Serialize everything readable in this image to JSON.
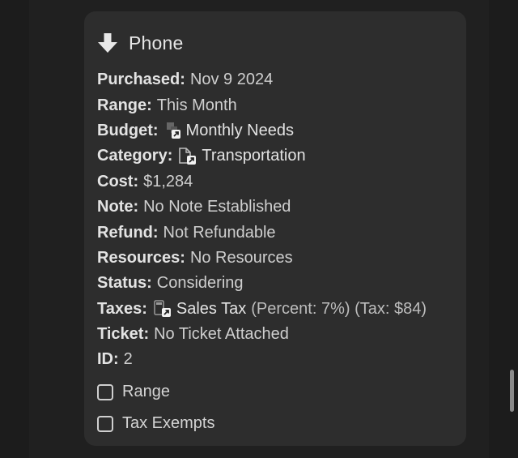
{
  "card": {
    "title": "Phone",
    "icon": "arrow-down-icon"
  },
  "properties": {
    "purchased": {
      "label": "Purchased:",
      "value": "Nov 9 2024"
    },
    "range": {
      "label": "Range:",
      "value": "This Month"
    },
    "budget": {
      "label": "Budget:",
      "value": "Monthly Needs",
      "icon": "page-link-icon"
    },
    "category": {
      "label": "Category:",
      "value": "Transportation",
      "icon": "document-link-icon"
    },
    "cost": {
      "label": "Cost:",
      "value": "$1,284"
    },
    "note": {
      "label": "Note:",
      "value": "No Note Established"
    },
    "refund": {
      "label": "Refund:",
      "value": "Not Refundable"
    },
    "resources": {
      "label": "Resources:",
      "value": "No Resources"
    },
    "status": {
      "label": "Status:",
      "value": "Considering"
    },
    "taxes": {
      "label": "Taxes:",
      "value": "Sales Tax",
      "detail": "(Percent: 7%) (Tax: $84)",
      "icon": "calculator-link-icon"
    },
    "ticket": {
      "label": "Ticket:",
      "value": "No Ticket Attached"
    },
    "id": {
      "label": "ID:",
      "value": "2"
    }
  },
  "checkboxes": [
    {
      "label": "Range",
      "checked": false
    },
    {
      "label": "Tax Exempts",
      "checked": false
    }
  ]
}
